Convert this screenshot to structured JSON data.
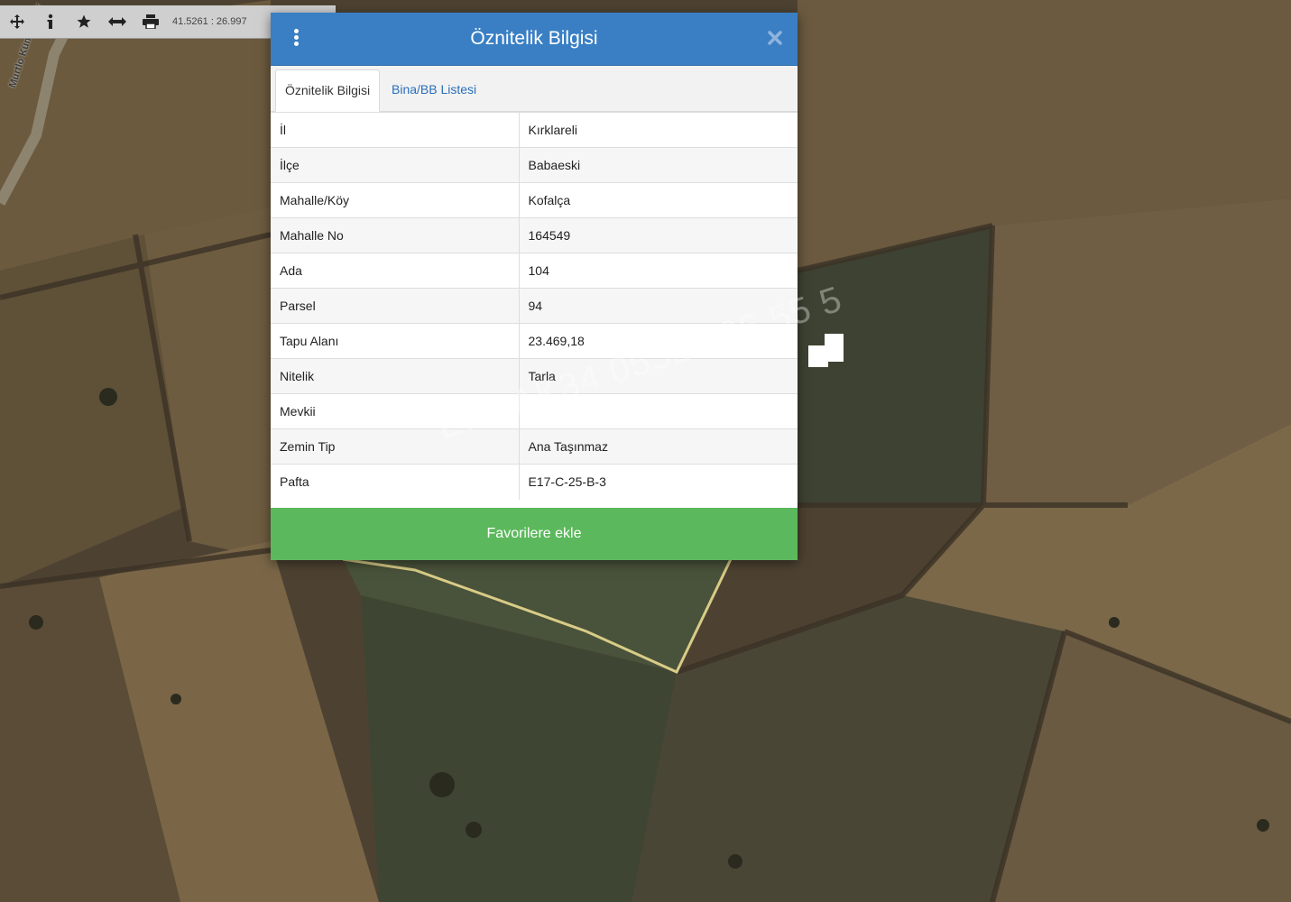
{
  "map": {
    "road_label": "Murtlo Küme Evler"
  },
  "toolbar": {
    "coords": "41.5261 : 26.997"
  },
  "dialog": {
    "title": "Öznitelik Bilgisi",
    "tabs": [
      "Öznitelik Bilgisi",
      "Bina/BB Listesi"
    ],
    "rows": [
      {
        "key": "İl",
        "value": "Kırklareli"
      },
      {
        "key": "İlçe",
        "value": "Babaeski"
      },
      {
        "key": "Mahalle/Köy",
        "value": "Kofalça"
      },
      {
        "key": "Mahalle No",
        "value": "164549"
      },
      {
        "key": "Ada",
        "value": "104"
      },
      {
        "key": "Parsel",
        "value": "94"
      },
      {
        "key": "Tapu Alanı",
        "value": "23.469,18"
      },
      {
        "key": "Nitelik",
        "value": "Tarla"
      },
      {
        "key": "Mevkii",
        "value": ""
      },
      {
        "key": "Zemin Tip",
        "value": "Ana Taşınmaz"
      },
      {
        "key": "Pafta",
        "value": "E17-C-25-B-3"
      }
    ],
    "favorite_label": "Favorilere ekle"
  },
  "watermark": "EMLAK34 0532 586 55 5",
  "colors": {
    "header_blue": "#3a7fc4",
    "tab_link_blue": "#2a6fb8",
    "favorite_green": "#5cb85c",
    "parcel_outline": "#d8cc86"
  }
}
